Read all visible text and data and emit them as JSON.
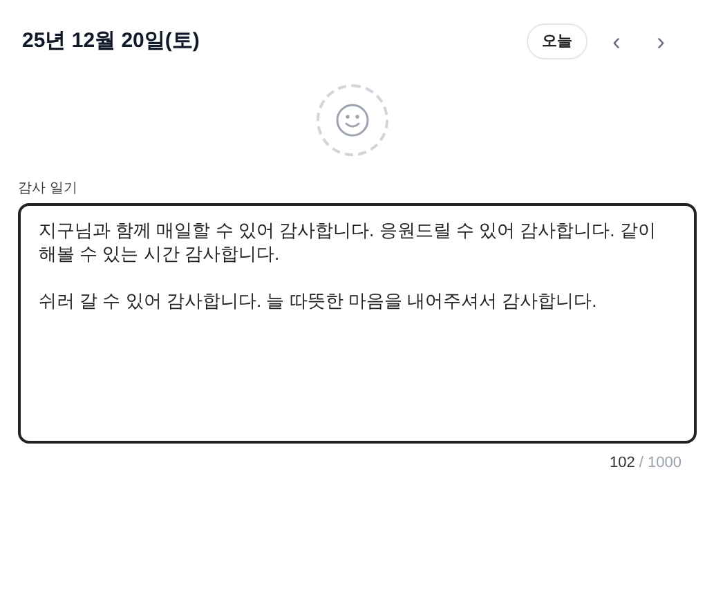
{
  "header": {
    "date": "25년 12월 20일(토)",
    "today_button": "오늘",
    "prev_button": "‹",
    "next_button": "›"
  },
  "mood": {
    "selected": false
  },
  "journal": {
    "label": "감사 일기",
    "value": "지구님과 함께 매일할 수 있어 감사합니다. 응원드릴 수 있어 감사합니다. 같이 해볼 수 있는 시간 감사합니다.\n\n쉬러 갈 수 있어 감사합니다. 늘 따뜻한 마음을 내어주셔서 감사합니다.",
    "count": "102",
    "limit": "/ 1000"
  }
}
